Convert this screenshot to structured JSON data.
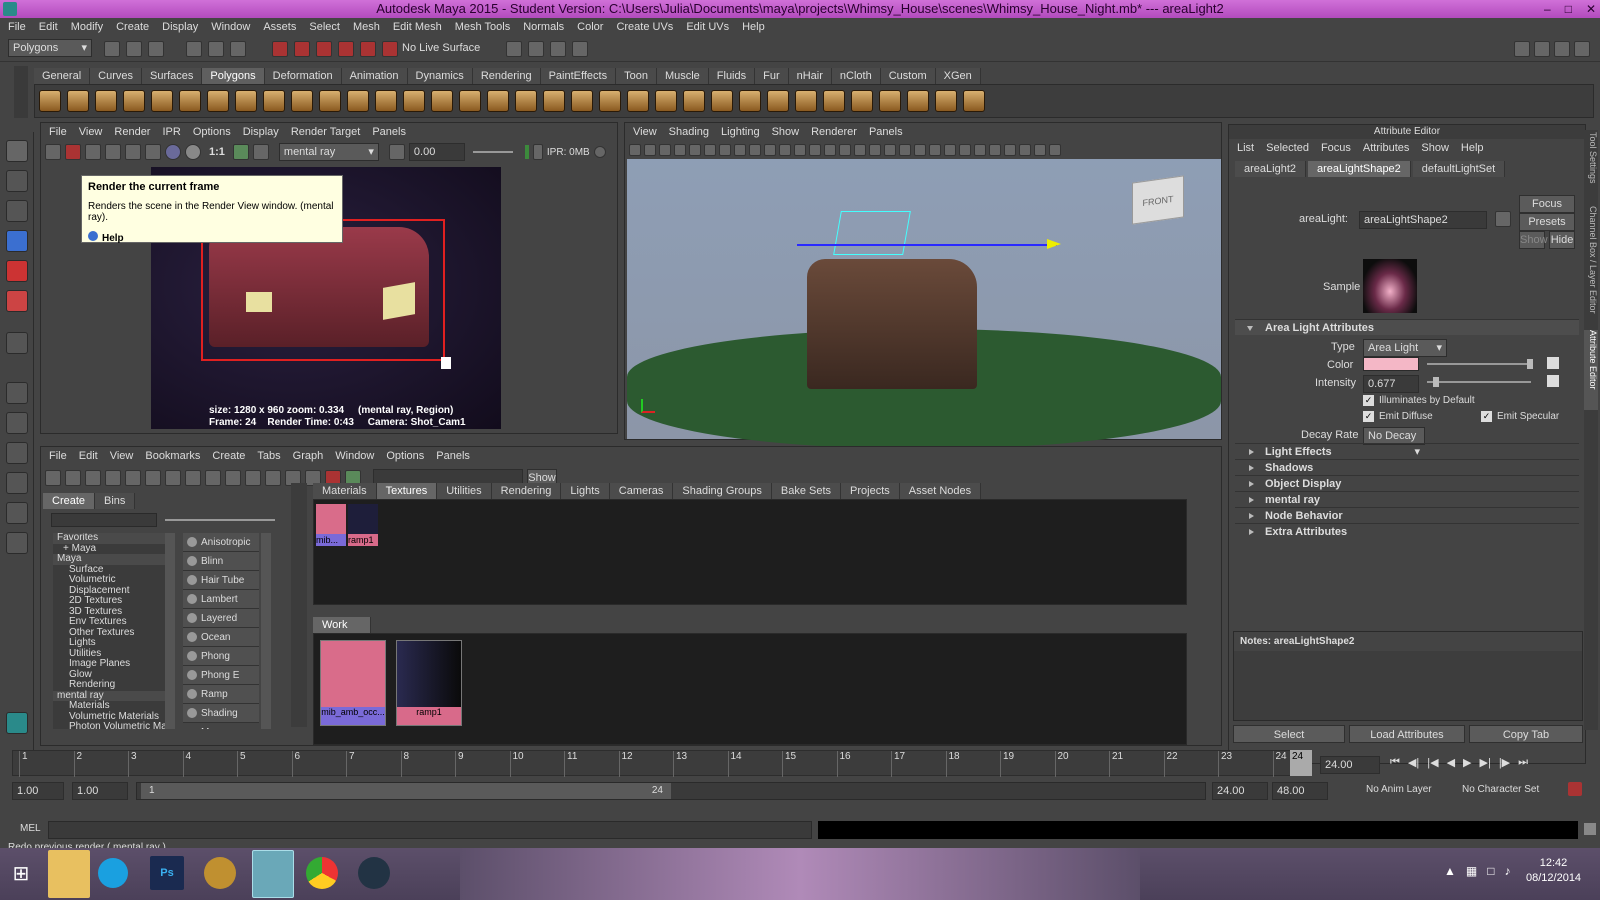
{
  "window": {
    "title": "Autodesk Maya 2015 - Student Version: C:\\Users\\Julia\\Documents\\maya\\projects\\Whimsy_House\\scenes\\Whimsy_House_Night.mb*  ---  areaLight2"
  },
  "menubar": [
    "File",
    "Edit",
    "Modify",
    "Create",
    "Display",
    "Window",
    "Assets",
    "Select",
    "Mesh",
    "Edit Mesh",
    "Mesh Tools",
    "Normals",
    "Color",
    "Create UVs",
    "Edit UVs",
    "Help"
  ],
  "statusline": {
    "mode": "Polygons",
    "live_surface": "No Live Surface"
  },
  "shelf_tabs": [
    "General",
    "Curves",
    "Surfaces",
    "Polygons",
    "Deformation",
    "Animation",
    "Dynamics",
    "Rendering",
    "PaintEffects",
    "Toon",
    "Muscle",
    "Fluids",
    "Fur",
    "nHair",
    "nCloth",
    "Custom",
    "XGen"
  ],
  "render_view": {
    "menu": [
      "File",
      "View",
      "Render",
      "IPR",
      "Options",
      "Display",
      "Render Target",
      "Panels"
    ],
    "one_to_one": "1:1",
    "camera_select": "mental ray",
    "exposure": "0.00",
    "ipr_label": "IPR: 0MB",
    "tooltip": {
      "title": "Render the current frame",
      "body": "Renders the scene in the Render View window. (mental ray).",
      "help": "Help"
    },
    "info_line1": "size: 1280 x 960  zoom: 0.334",
    "info_line1b": "(mental ray, Region)",
    "info_line2a": "Frame: 24",
    "info_line2b": "Render Time: 0:43",
    "info_line2c": "Camera: Shot_Cam1"
  },
  "viewport": {
    "menu": [
      "View",
      "Shading",
      "Lighting",
      "Show",
      "Renderer",
      "Panels"
    ],
    "viewcube_label": "FRONT"
  },
  "hypershade": {
    "menu": [
      "File",
      "Edit",
      "View",
      "Bookmarks",
      "Create",
      "Tabs",
      "Graph",
      "Window",
      "Options",
      "Panels"
    ],
    "show_btn": "Show",
    "left_tabs": [
      "Create",
      "Bins"
    ],
    "tree": [
      "Favorites",
      "+ Maya",
      "Maya",
      "Surface",
      "Volumetric",
      "Displacement",
      "2D Textures",
      "3D Textures",
      "Env Textures",
      "Other Textures",
      "Lights",
      "Utilities",
      "Image Planes",
      "Glow",
      "Rendering",
      "mental ray",
      "Materials",
      "Volumetric Materials",
      "Photon Volumetric Ma..."
    ],
    "shaders": [
      "Anisotropic",
      "Blinn",
      "Hair Tube Sha",
      "Lambert",
      "Layered Shade",
      "Ocean Shader",
      "Phong",
      "Phong E",
      "Ramp Shader",
      "Shading Map"
    ],
    "tabs": [
      "Materials",
      "Textures",
      "Utilities",
      "Rendering",
      "Lights",
      "Cameras",
      "Shading Groups",
      "Bake Sets",
      "Projects",
      "Asset Nodes"
    ],
    "swatches": [
      {
        "label": "mib...",
        "color": "#d96c8a"
      },
      {
        "label": "ramp1",
        "color": "#1e1e3a"
      }
    ],
    "work_area_label": "Work Area",
    "work_nodes": [
      {
        "label": "mib_amb_occ...",
        "color": "#d96c8a"
      },
      {
        "label": "ramp1",
        "color": "#22223e"
      }
    ]
  },
  "attribute_editor": {
    "title": "Attribute Editor",
    "menu": [
      "List",
      "Selected",
      "Focus",
      "Attributes",
      "Show",
      "Help"
    ],
    "tabs": [
      "areaLight2",
      "areaLightShape2",
      "defaultLightSet"
    ],
    "node_label": "areaLight:",
    "node_value": "areaLightShape2",
    "focus": "Focus",
    "presets": "Presets",
    "show": "Show",
    "hide": "Hide",
    "sample_label": "Sample",
    "area_section": "Area Light Attributes",
    "type_label": "Type",
    "type_value": "Area Light",
    "color_label": "Color",
    "color_value": "#f4b7c6",
    "intensity_label": "Intensity",
    "intensity_value": "0.677",
    "illuminates": "Illuminates by Default",
    "emit_diffuse": "Emit Diffuse",
    "emit_specular": "Emit Specular",
    "decay_label": "Decay Rate",
    "decay_value": "No Decay",
    "sections": [
      "Light Effects",
      "Shadows",
      "Object Display",
      "mental ray",
      "Node Behavior",
      "Extra Attributes"
    ],
    "notes": "Notes: areaLightShape2",
    "select_btn": "Select",
    "load_btn": "Load Attributes",
    "copy_btn": "Copy Tab"
  },
  "side_tabs": [
    "Tool Settings",
    "Channel Box / Layer Editor",
    "Attribute Editor"
  ],
  "timeline": {
    "ticks": [
      "1",
      "2",
      "3",
      "4",
      "5",
      "6",
      "7",
      "8",
      "9",
      "10",
      "11",
      "12",
      "13",
      "14",
      "15",
      "16",
      "17",
      "18",
      "19",
      "20",
      "21",
      "22",
      "23",
      "24"
    ],
    "current_frame": "24",
    "current_field": "24.00"
  },
  "range": {
    "start": "1.00",
    "start2": "1.00",
    "slider_start": "1",
    "slider_end": "24",
    "end": "24.00",
    "end2": "48.00",
    "anim_layer": "No Anim Layer",
    "char_set": "No Character Set"
  },
  "command_line": {
    "label": "MEL"
  },
  "help_line": "Redo previous render ( mental ray )",
  "taskbar": {
    "time": "12:42",
    "date": "08/12/2014"
  }
}
